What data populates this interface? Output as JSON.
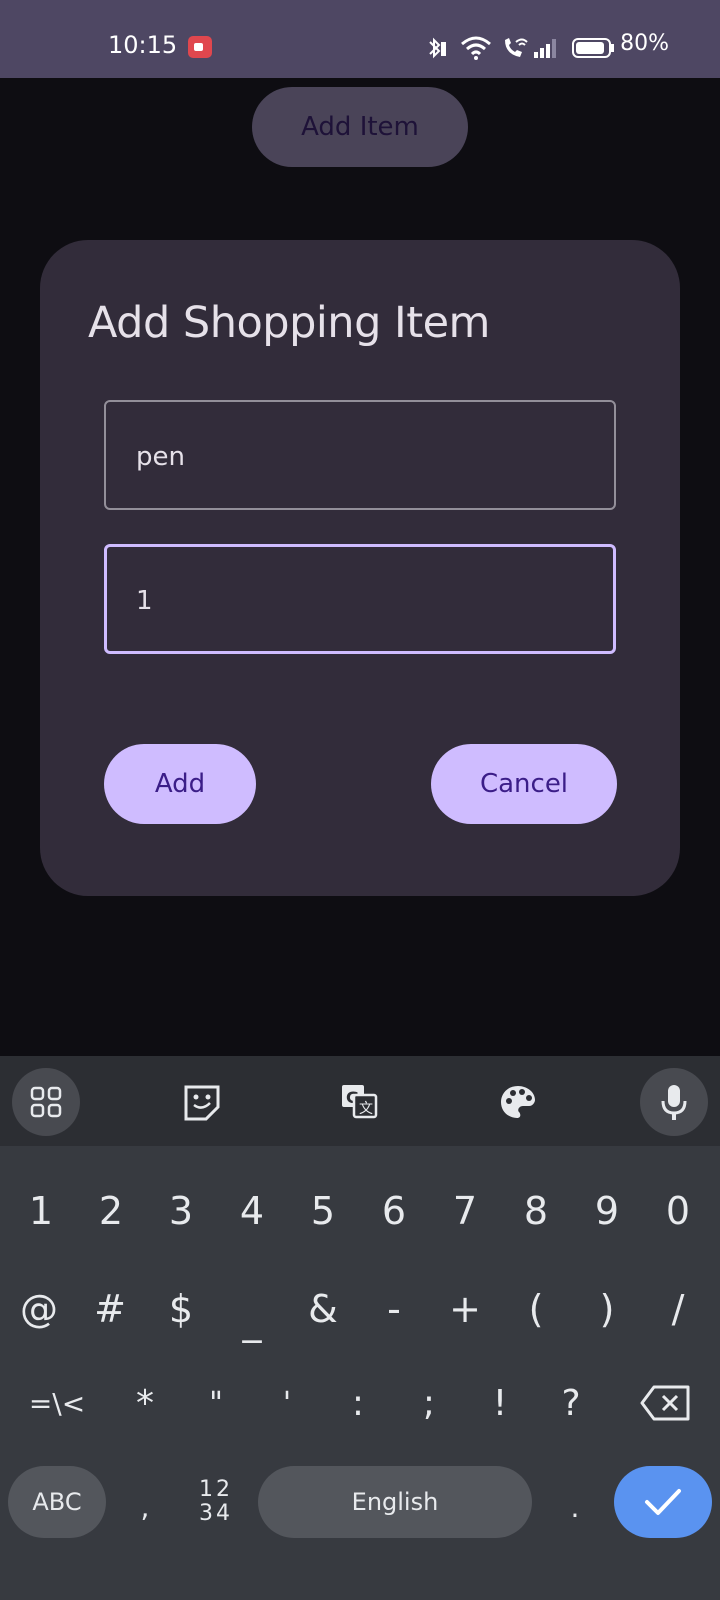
{
  "status_bar": {
    "time": "10:15",
    "battery": "80%",
    "icons": [
      "screen-record-icon",
      "bluetooth-icon",
      "wifi-icon",
      "wifi-calling-icon",
      "signal-icon",
      "battery-icon"
    ]
  },
  "background": {
    "add_item_label": "Add Item"
  },
  "dialog": {
    "title": "Add Shopping Item",
    "name_value": "pen",
    "quantity_value": "1",
    "add_label": "Add",
    "cancel_label": "Cancel"
  },
  "keyboard": {
    "toolbar": [
      "apps-grid-icon",
      "sticker-icon",
      "translate-icon",
      "palette-icon",
      "microphone-icon"
    ],
    "row_numbers": [
      "1",
      "2",
      "3",
      "4",
      "5",
      "6",
      "7",
      "8",
      "9",
      "0"
    ],
    "row_symbols_1": [
      "@",
      "#",
      "$",
      "_",
      "&",
      "-",
      "+",
      "(",
      ")",
      "/"
    ],
    "row_symbols_2": [
      "=\\<",
      "*",
      "\"",
      "'",
      ":",
      ";",
      "!",
      "?"
    ],
    "abc_label": "ABC",
    "comma": ",",
    "num_label_top": "12",
    "num_label_bottom": "34",
    "space_label": "English",
    "period": ".",
    "colors": {
      "accent": "#cfbcff",
      "done": "#5a93f0"
    }
  }
}
